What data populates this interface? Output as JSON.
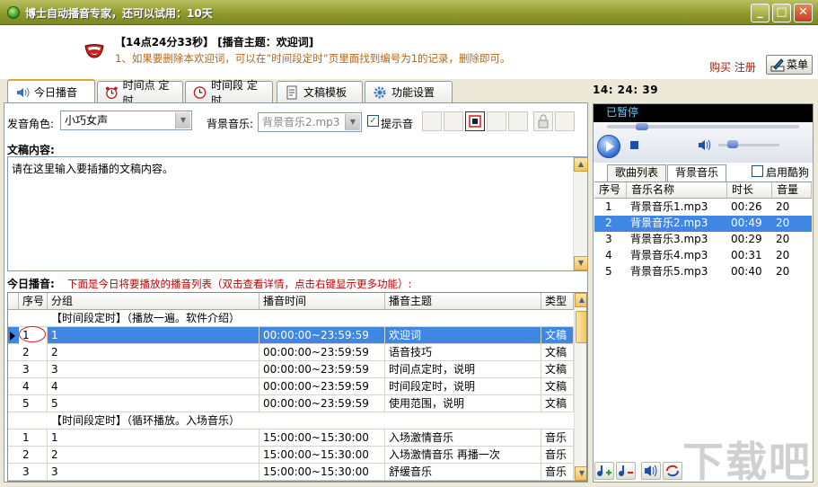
{
  "window": {
    "title": "博士自动播音专家，还可以试用：10天"
  },
  "header": {
    "line1": "【14点24分33秒】 [播音主题：欢迎词]",
    "line2": "1、如果要删除本欢迎词，可以在”时间段定时”页里面找到编号为1的记录，删除即可。",
    "buy_label": "购买 注册",
    "menu_label": "菜单"
  },
  "clock": "14: 24: 39",
  "tabs": [
    {
      "label": "今日播音",
      "icon": "speaker-icon"
    },
    {
      "label": "时间点 定时",
      "icon": "alarm-clock-icon"
    },
    {
      "label": "时间段 定时",
      "icon": "clock-icon"
    },
    {
      "label": "文稿模板",
      "icon": "document-icon"
    },
    {
      "label": "功能设置",
      "icon": "gear-icon"
    }
  ],
  "form": {
    "role_label": "发音角色:",
    "role_value": "小巧女声",
    "music_label": "背景音乐:",
    "music_value": "背景音乐2.mp3",
    "prompt_label": "提示音",
    "content_label": "文稿内容:",
    "content_text": "请在这里输入要插播的文稿内容。"
  },
  "today": {
    "label": "今日播音:",
    "hint": "下面是今日将要播放的播音列表（双击查看详情，点击右键显示更多功能）:"
  },
  "schedule": {
    "columns": [
      "序号",
      "分组",
      "播音时间",
      "播音主题",
      "类型"
    ],
    "rows": [
      {
        "group": "【时间段定时】（播放一遍。软件介绍）"
      },
      {
        "no": "1",
        "group_no": "1",
        "time": "00:00:00~23:59:59",
        "topic": "欢迎词",
        "type": "文稿",
        "selected": true
      },
      {
        "no": "2",
        "group_no": "2",
        "time": "00:00:00~23:59:59",
        "topic": "语音技巧",
        "type": "文稿"
      },
      {
        "no": "3",
        "group_no": "3",
        "time": "00:00:00~23:59:59",
        "topic": "时间点定时，说明",
        "type": "文稿"
      },
      {
        "no": "4",
        "group_no": "4",
        "time": "00:00:00~23:59:59",
        "topic": "时间段定时，说明",
        "type": "文稿"
      },
      {
        "no": "5",
        "group_no": "5",
        "time": "00:00:00~23:59:59",
        "topic": "使用范围，说明",
        "type": "文稿"
      },
      {
        "group": "【时间段定时】（循环播放。入场音乐）"
      },
      {
        "no": "1",
        "group_no": "1",
        "time": "15:00:00~15:30:00",
        "topic": "入场激情音乐",
        "type": "音乐"
      },
      {
        "no": "2",
        "group_no": "2",
        "time": "15:00:00~15:30:00",
        "topic": "入场激情音乐 再播一次",
        "type": "音乐"
      },
      {
        "no": "3",
        "group_no": "3",
        "time": "15:00:00~15:30:00",
        "topic": "舒缓音乐",
        "type": "音乐"
      }
    ]
  },
  "player": {
    "status": "已暂停"
  },
  "right_tabs": [
    {
      "label": "歌曲列表"
    },
    {
      "label": "背景音乐"
    }
  ],
  "cool_label": "启用酷狗",
  "songs": {
    "columns": [
      "序号",
      "音乐名称",
      "时长",
      "音量"
    ],
    "rows": [
      {
        "no": "1",
        "name": "背景音乐1.mp3",
        "duration": "00:26",
        "volume": "20"
      },
      {
        "no": "2",
        "name": "背景音乐2.mp3",
        "duration": "00:49",
        "volume": "20",
        "selected": true
      },
      {
        "no": "3",
        "name": "背景音乐3.mp3",
        "duration": "00:29",
        "volume": "20"
      },
      {
        "no": "4",
        "name": "背景音乐4.mp3",
        "duration": "00:31",
        "volume": "20"
      },
      {
        "no": "5",
        "name": "背景音乐5.mp3",
        "duration": "00:40",
        "volume": "20"
      }
    ]
  },
  "watermark": "下载吧",
  "colors": {
    "accent": "#3f87e3",
    "titlebar": "#8f9a2a",
    "hint_red": "#c00000",
    "header_orange": "#b4661a"
  }
}
